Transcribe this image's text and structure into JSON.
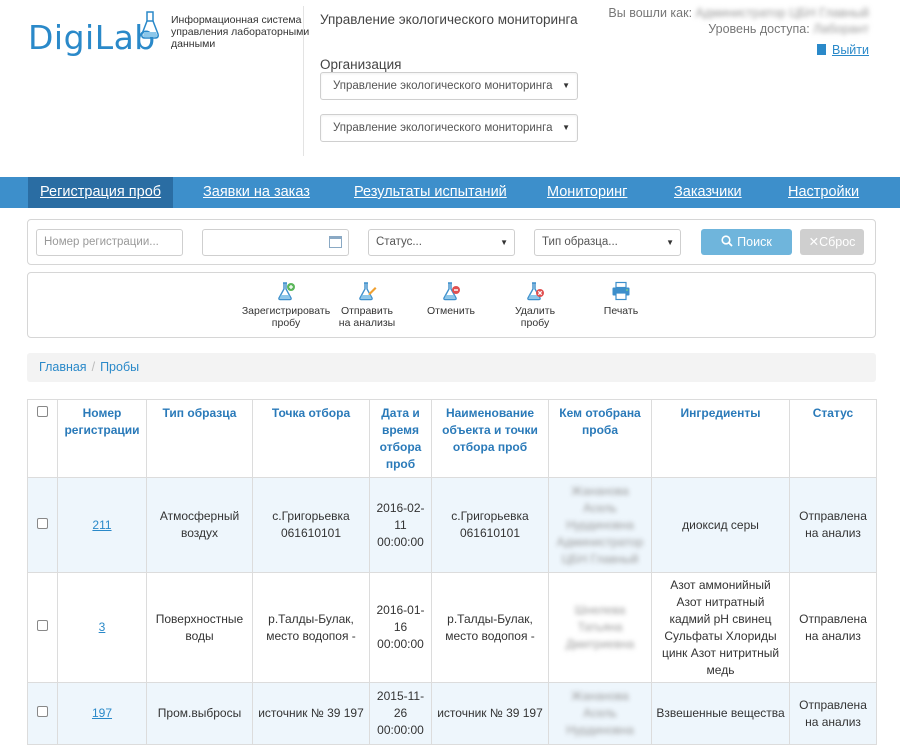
{
  "header": {
    "logo_text": "DigiLab",
    "system_name": "Информационная система управления лабораторными данными",
    "dept_title": "Управление экологического мониторинга",
    "org_label": "Организация",
    "org_select_1": "Управление экологического мониторинга",
    "org_select_2": "Управление экологического мониторинга",
    "logged_in_label": "Вы вошли как:",
    "logged_in_user": "Администратор ЦБН Главный",
    "access_label": "Уровень доступа:",
    "access_value": "Лаборант",
    "logout": "Выйти"
  },
  "nav": {
    "items": [
      {
        "label": "Регистрация проб",
        "active": true
      },
      {
        "label": "Заявки на заказ",
        "active": false
      },
      {
        "label": "Результаты испытаний",
        "active": false
      },
      {
        "label": "Мониторинг",
        "active": false
      },
      {
        "label": "Заказчики",
        "active": false
      },
      {
        "label": "Настройки",
        "active": false
      }
    ]
  },
  "filters": {
    "reg_number_placeholder": "Номер регистрации...",
    "date_value": "",
    "status_placeholder": "Статус...",
    "sample_type_placeholder": "Тип образца...",
    "search_label": "Поиск",
    "reset_label": "Сброс"
  },
  "actions": {
    "register": "Зарегистрировать пробу",
    "send": "Отправить на анализы",
    "cancel": "Отменить",
    "delete": "Удалить пробу",
    "print": "Печать"
  },
  "breadcrumb": {
    "home": "Главная",
    "current": "Пробы"
  },
  "table": {
    "headers": {
      "reg": "Номер регистрации",
      "type": "Тип образца",
      "point": "Точка отбора",
      "date": "Дата и время отбора проб",
      "name": "Наименование объекта и точки отбора проб",
      "taken_by": "Кем отобрана проба",
      "ingredients": "Ингредиенты",
      "status": "Статус"
    },
    "rows": [
      {
        "reg": "211",
        "type": "Атмосферный воздух",
        "point": "с.Григорьевка 061610101",
        "date": "2016-02-11 00:00:00",
        "name": "с.Григорьевка 061610101",
        "taken_by": "Жананова Асель Нурдиновна Администратор ЦБН Главный",
        "ingredients": "диоксид серы",
        "status": "Отправлена на анализ"
      },
      {
        "reg": "3",
        "type": "Поверхностные воды",
        "point": "р.Талды-Булак, место водопоя -",
        "date": "2016-01-16 00:00:00",
        "name": "р.Талды-Булак, место водопоя -",
        "taken_by": "Шнелева Татьяна Дмитриевна",
        "ingredients": "Азот аммонийный Азот нитратный кадмий pH свинец Сульфаты Хлориды цинк Азот нитритный медь",
        "status": "Отправлена на анализ"
      },
      {
        "reg": "197",
        "type": "Пром.выбросы",
        "point": "источник № 39 197",
        "date": "2015-11-26 00:00:00",
        "name": "источник № 39 197",
        "taken_by": "Жананова Асель Нурдиновна",
        "ingredients": "Взвешенные вещества",
        "status": "Отправлена на анализ"
      }
    ]
  }
}
